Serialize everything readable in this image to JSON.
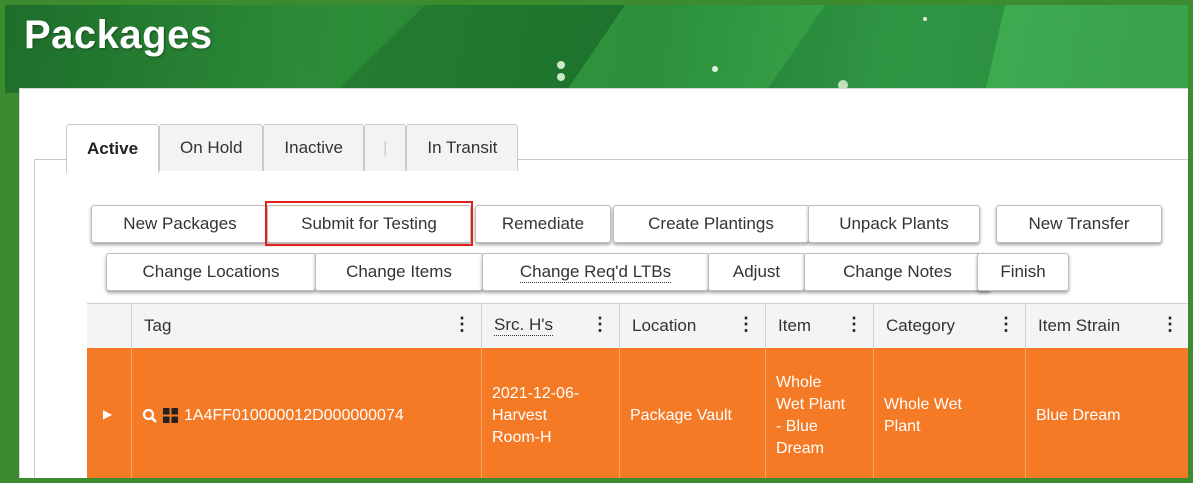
{
  "header": {
    "title": "Packages"
  },
  "tabs": [
    {
      "label": "Active",
      "active": true
    },
    {
      "label": "On Hold"
    },
    {
      "label": "Inactive"
    },
    {
      "label": "|"
    },
    {
      "label": "In Transit"
    }
  ],
  "toolbar": {
    "row1": [
      "New Packages",
      "Submit for Testing",
      "Remediate",
      "Create Plantings",
      "Unpack Plants",
      "New Transfer"
    ],
    "row2": [
      "Change Locations",
      "Change Items",
      "Change Req'd LTBs",
      "Adjust",
      "Change Notes",
      "Finish"
    ]
  },
  "table": {
    "columns": [
      "Tag",
      "Src. H's",
      "Location",
      "Item",
      "Category",
      "Item Strain"
    ],
    "rows": [
      {
        "tag": "1A4FF010000012D000000074",
        "src": [
          "2021-12-06-",
          "Harvest",
          "Room-H"
        ],
        "location": "Package Vault",
        "item": [
          "Whole",
          "Wet Plant",
          "- Blue",
          "Dream"
        ],
        "category": [
          "Whole Wet",
          "Plant"
        ],
        "strain": "Blue Dream"
      }
    ]
  },
  "colors": {
    "row_highlight": "#f47a25",
    "highlight_box": "#e0221d",
    "banner": "#2f8f3a"
  }
}
